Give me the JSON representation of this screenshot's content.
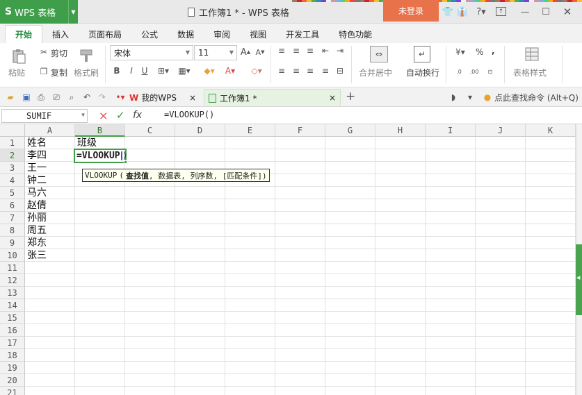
{
  "app": {
    "logo": "S",
    "name": "WPS 表格",
    "doc_title": "工作簿1 * - WPS 表格",
    "login": "未登录"
  },
  "titlebar_icons": [
    "shirt-icon",
    "skin-icon",
    "help-icon",
    "restore-icon",
    "minimize-icon",
    "maximize-icon",
    "close-icon"
  ],
  "colors": {
    "accent": "#3f9e49",
    "login": "#e8734b",
    "active_tab": "#1a8a3a",
    "cancel": "#e0504a",
    "confirm": "#3a9a3a"
  },
  "tabs": [
    "开始",
    "插入",
    "页面布局",
    "公式",
    "数据",
    "审阅",
    "视图",
    "开发工具",
    "特色功能"
  ],
  "ribbon": {
    "paste": "粘贴",
    "cut": "剪切",
    "copy": "复制",
    "format_painter": "格式刷",
    "font_name": "宋体",
    "font_size": "11",
    "bold": "B",
    "italic": "I",
    "underline": "U",
    "merge_center": "合并居中",
    "wrap_text": "自动换行",
    "table_style": "表格样式",
    "percent": "%",
    "comma": ","
  },
  "docbar": {
    "tab1": "我的WPS",
    "tab2": "工作簿1 *",
    "new_tab": "+",
    "search": "点此查找命令 (Alt+Q)"
  },
  "formula": {
    "name_box": "SUMIF",
    "cancel": "×",
    "confirm": "✓",
    "fx": "fx",
    "content": "=VLOOKUP()"
  },
  "sheet": {
    "columns": [
      "A",
      "B",
      "C",
      "D",
      "E",
      "F",
      "G",
      "H",
      "I",
      "J",
      "K"
    ],
    "rows": [
      "1",
      "2",
      "3",
      "4",
      "5",
      "6",
      "7",
      "8",
      "9",
      "10",
      "11",
      "12",
      "13",
      "14",
      "15",
      "16",
      "17",
      "18",
      "19",
      "20",
      "21"
    ],
    "a1": "姓名",
    "b1": "班级",
    "names": [
      "李四",
      "王一",
      "钟二",
      "马六",
      "赵倩",
      "孙丽",
      "周五",
      "郑东",
      "张三"
    ],
    "b2_formula": "=VLOOKUP",
    "b2_close": ")",
    "tooltip": {
      "fn": "VLOOKUP",
      "open": "(",
      "arg1": "查找值",
      "rest": ", 数据表, 列序数, [匹配条件])"
    }
  }
}
